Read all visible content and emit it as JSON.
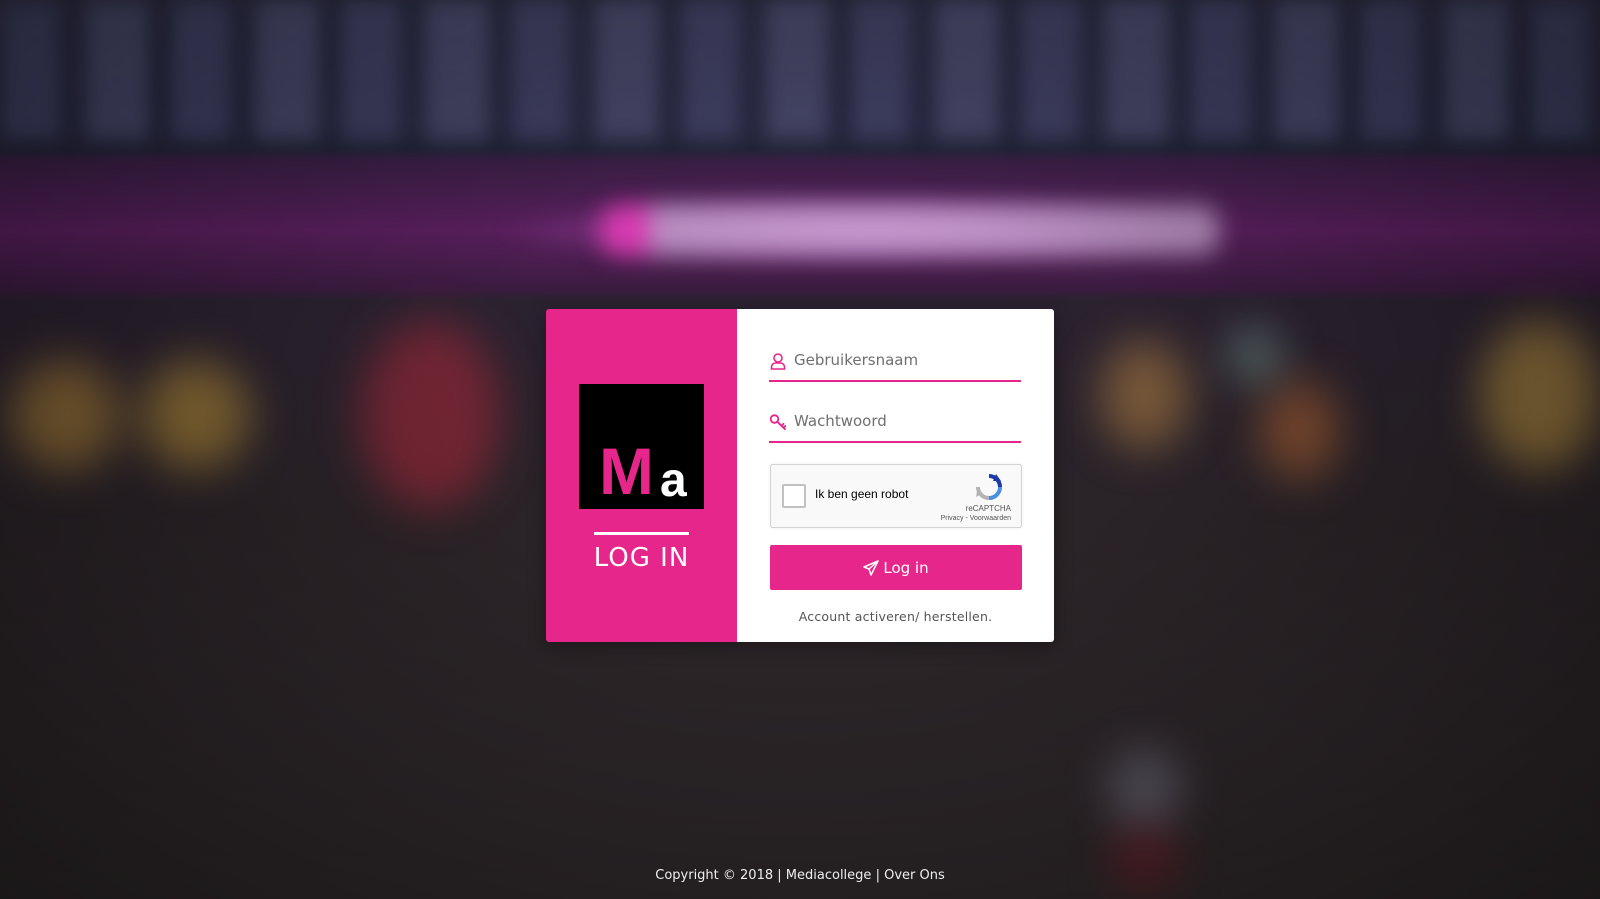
{
  "login_panel": {
    "logo": {
      "big_letter": "M",
      "small_letter": "a"
    },
    "title": "LOG IN"
  },
  "form": {
    "username": {
      "placeholder": "Gebruikersnaam",
      "value": "",
      "icon": "user-icon"
    },
    "password": {
      "placeholder": "Wachtwoord",
      "value": "",
      "icon": "key-icon"
    },
    "captcha": {
      "label": "Ik ben geen robot",
      "brand": "reCAPTCHA",
      "links": "Privacy - Voorwaarden",
      "checked": false
    },
    "submit_label": "Log in",
    "submit_icon": "paper-plane-icon",
    "activate_link": "Account activeren/ herstellen."
  },
  "footer": {
    "copyright": "Copyright © 2018",
    "sep1": "|",
    "link1": "Mediacollege",
    "sep2": "|",
    "link2": "Over Ons"
  },
  "colors": {
    "accent": "#e6268a",
    "logo_bg": "#000000"
  }
}
